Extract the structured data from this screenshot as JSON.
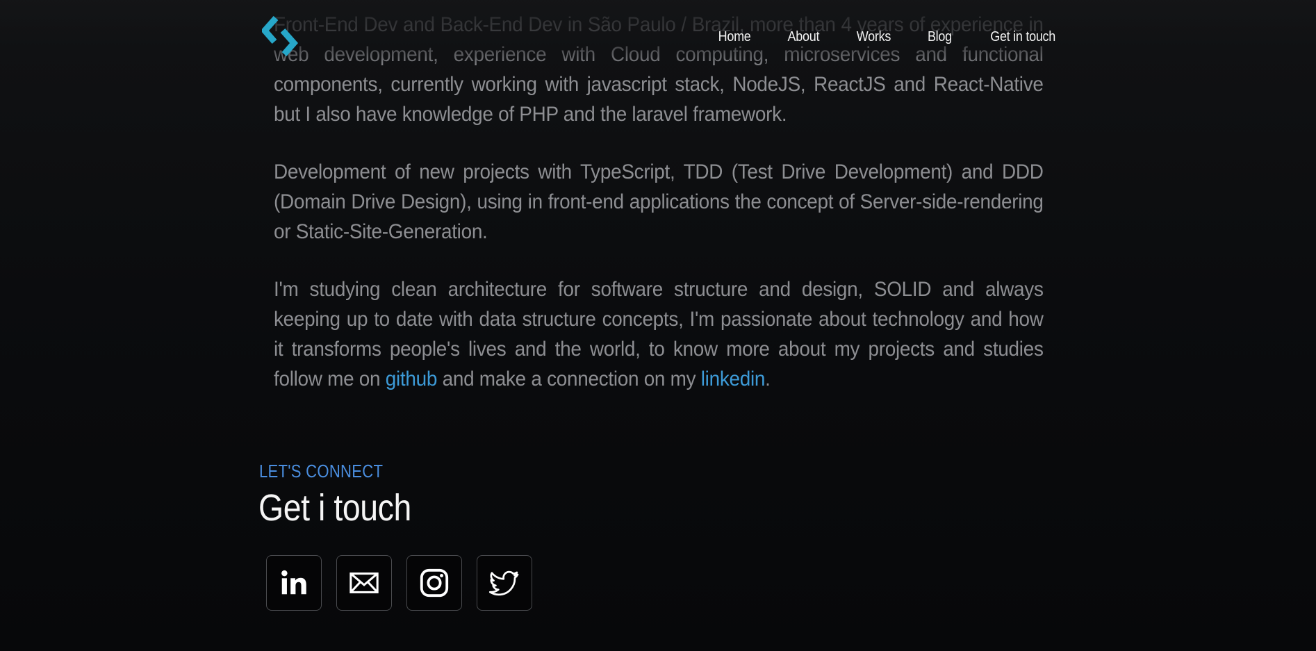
{
  "header": {
    "nav": [
      "Home",
      "About",
      "Works",
      "Blog",
      "Get in touch"
    ]
  },
  "about": {
    "p1": "Front-End Dev and Back-End Dev in São Paulo / Brazil, more than 4 years of experience in web development, experience with Cloud computing, microservices and functional components, currently working with javascript stack, NodeJS, ReactJS and React-Native but I also have knowledge of PHP and the laravel framework.",
    "p2": "Development of new projects with TypeScript, TDD (Test Drive Development) and DDD (Domain Drive Design), using in front-end applications the concept of Server-side-rendering or Static-Site-Generation.",
    "p3_a": "I'm studying clean architecture for software structure and design, SOLID and always keeping up to date with data structure concepts, I'm passionate about technology and how it transforms people's lives and the world, to know more about my projects and studies follow me on ",
    "p3_link1": "github",
    "p3_b": " and make a connection on my ",
    "p3_link2": "linkedin",
    "p3_c": "."
  },
  "connect": {
    "eyebrow": "LET'S CONNECT",
    "title": "Get i touch",
    "socials": [
      "linkedin-icon",
      "mail-icon",
      "instagram-icon",
      "twitter-icon"
    ]
  },
  "colors": {
    "accent": "#3d9bd8",
    "eyebrow": "#4a8ee0",
    "logo": "#27a7c9"
  }
}
